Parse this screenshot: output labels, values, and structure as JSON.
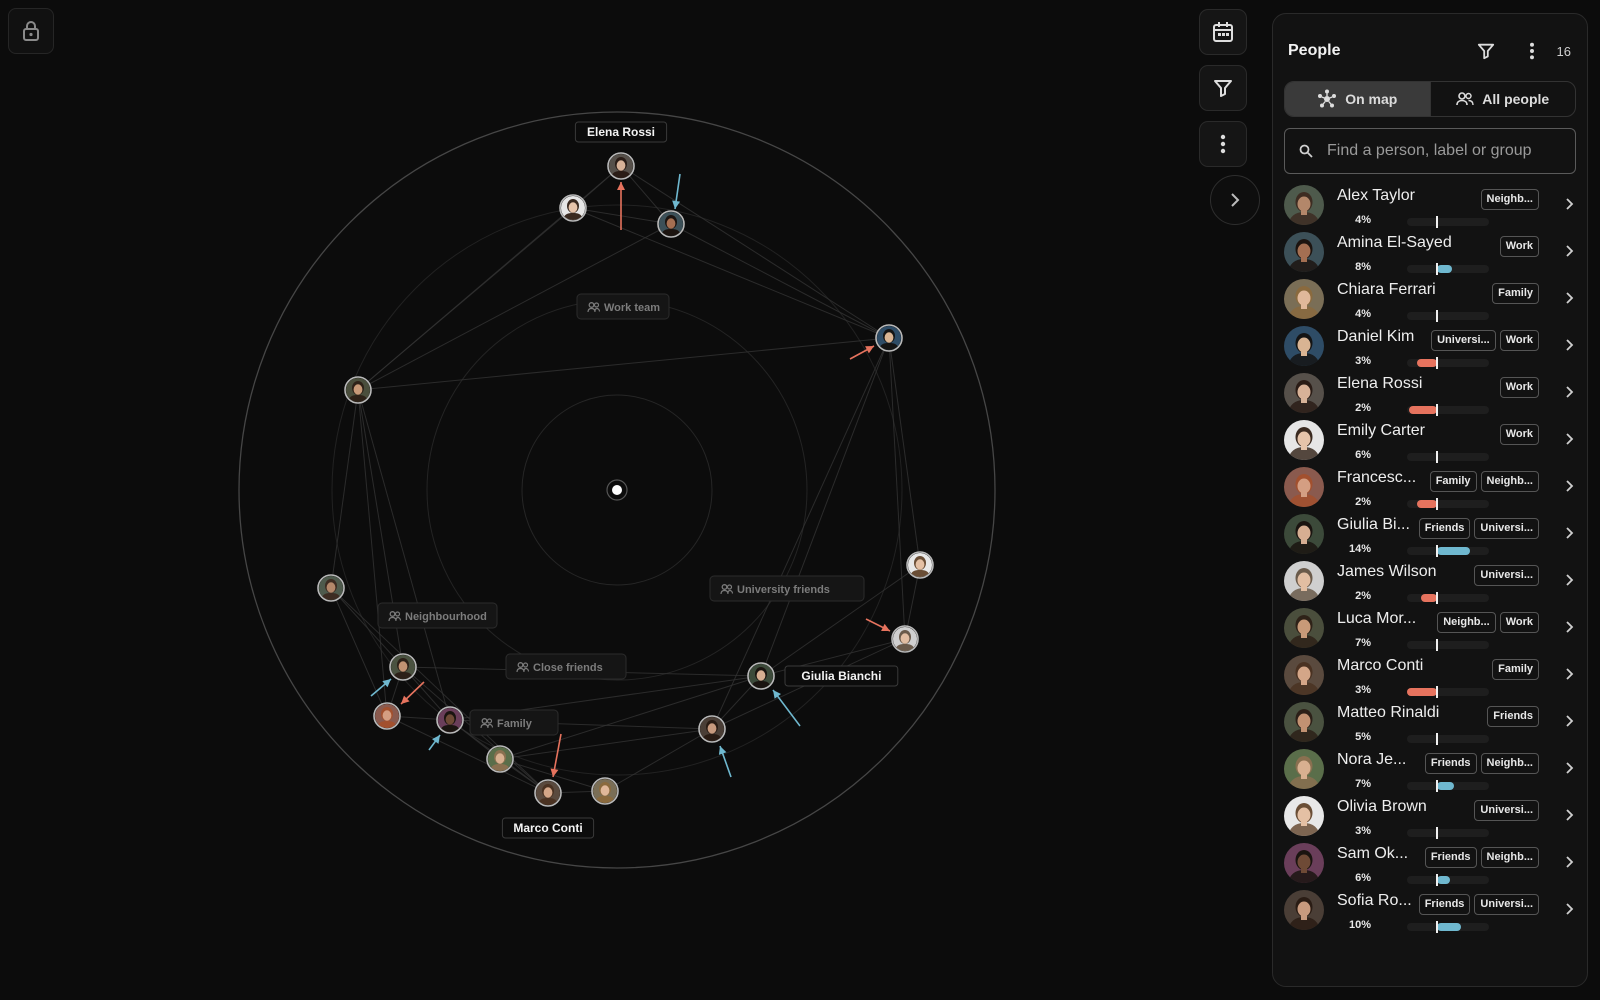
{
  "toolbar": {
    "lock_icon": "lock-icon",
    "calendar_icon": "calendar-icon",
    "filter_icon": "filter-icon",
    "more_icon": "more-vertical-icon",
    "collapse_icon": "chevron-right-icon"
  },
  "colors": {
    "background": "#0c0c0c",
    "panel": "#121212",
    "increase": "#6fb8cf",
    "decrease": "#e6735e",
    "ring": "#3a3a3a",
    "edge": "#2e2e2e"
  },
  "map": {
    "node_labels": [
      {
        "person": "Elena Rossi",
        "text": "Elena Rossi"
      },
      {
        "person": "Giulia Bianchi",
        "text": "Giulia Bianchi"
      },
      {
        "person": "Marco Conti",
        "text": "Marco Conti"
      }
    ],
    "groups": [
      "Work team",
      "University friends",
      "Neighbourhood",
      "Close friends",
      "Family"
    ]
  },
  "panel": {
    "title": "People",
    "count": "16",
    "tabs": [
      {
        "label": "On map",
        "active": true,
        "icon": "network-icon"
      },
      {
        "label": "All people",
        "active": false,
        "icon": "people-icon"
      }
    ],
    "search_placeholder": "Find a person, label or group"
  },
  "people": [
    {
      "name": "Alex Taylor",
      "tags": [
        "Neighb..."
      ],
      "pct": "4%",
      "change": 0,
      "skin": "#b3876a",
      "hair": "#3d2c22",
      "bg": "#4e5a4c"
    },
    {
      "name": "Amina El-Sayed",
      "tags": [
        "Work"
      ],
      "pct": "8%",
      "change": 0.08,
      "skin": "#a46f52",
      "hair": "#1c1410",
      "bg": "#3c5058"
    },
    {
      "name": "Chiara Ferrari",
      "tags": [
        "Family"
      ],
      "pct": "4%",
      "change": 0,
      "skin": "#e0b89a",
      "hair": "#8a6a3e",
      "bg": "#7a6e56"
    },
    {
      "name": "Daniel Kim",
      "tags": [
        "Universi...",
        "Work"
      ],
      "pct": "3%",
      "change": -0.05,
      "skin": "#d9b493",
      "hair": "#141414",
      "bg": "#2e4c66"
    },
    {
      "name": "Elena Rossi",
      "tags": [
        "Work"
      ],
      "pct": "2%",
      "change": -0.07,
      "skin": "#d8b298",
      "hair": "#2a1c16",
      "bg": "#56504a"
    },
    {
      "name": "Emily Carter",
      "tags": [
        "Work"
      ],
      "pct": "6%",
      "change": 0,
      "skin": "#e6c4aa",
      "hair": "#3a2a20",
      "bg": "#e6e6e6"
    },
    {
      "name": "Francesc...",
      "tags": [
        "Family",
        "Neighb..."
      ],
      "pct": "2%",
      "change": -0.05,
      "skin": "#d49e82",
      "hair": "#a2502e",
      "bg": "#8a5a4e"
    },
    {
      "name": "Giulia Bi...",
      "tags": [
        "Friends",
        "Universi..."
      ],
      "pct": "14%",
      "change": 0.18,
      "skin": "#d6ae92",
      "hair": "#1a1410",
      "bg": "#3c4a3a"
    },
    {
      "name": "James Wilson",
      "tags": [
        "Universi..."
      ],
      "pct": "2%",
      "change": -0.04,
      "skin": "#e2bea2",
      "hair": "#6a5a4a",
      "bg": "#cfcfcf"
    },
    {
      "name": "Luca Mor...",
      "tags": [
        "Neighb...",
        "Work"
      ],
      "pct": "7%",
      "change": 0,
      "skin": "#c89a78",
      "hair": "#2e2218",
      "bg": "#4a4e3c"
    },
    {
      "name": "Marco Conti",
      "tags": [
        "Family"
      ],
      "pct": "3%",
      "change": -0.08,
      "skin": "#d4a688",
      "hair": "#4a3222",
      "bg": "#5a4a3e"
    },
    {
      "name": "Matteo Rinaldi",
      "tags": [
        "Friends"
      ],
      "pct": "5%",
      "change": 0,
      "skin": "#c29272",
      "hair": "#2c2018",
      "bg": "#4a5240"
    },
    {
      "name": "Nora Je...",
      "tags": [
        "Friends",
        "Neighb..."
      ],
      "pct": "7%",
      "change": 0.09,
      "skin": "#d8b090",
      "hair": "#8a7050",
      "bg": "#5a6e4a"
    },
    {
      "name": "Olivia Brown",
      "tags": [
        "Universi..."
      ],
      "pct": "3%",
      "change": 0,
      "skin": "#e4c0a4",
      "hair": "#6a4e36",
      "bg": "#e8e8e8"
    },
    {
      "name": "Sam Ok...",
      "tags": [
        "Friends",
        "Neighb..."
      ],
      "pct": "6%",
      "change": 0.07,
      "skin": "#6e4a36",
      "hair": "#1a1410",
      "bg": "#6a3e5a"
    },
    {
      "name": "Sofia Ro...",
      "tags": [
        "Friends",
        "Universi..."
      ],
      "pct": "10%",
      "change": 0.13,
      "skin": "#c89a7e",
      "hair": "#2a1c14",
      "bg": "#4a3e36"
    }
  ]
}
